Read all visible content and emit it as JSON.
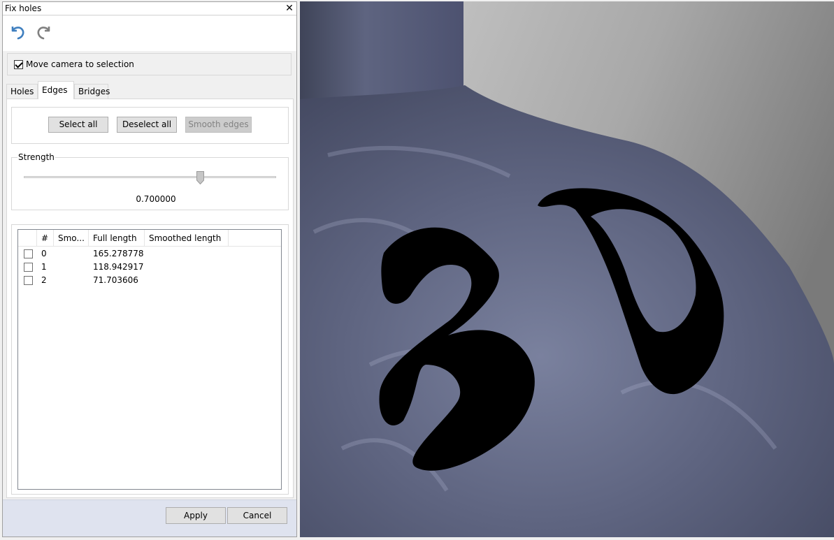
{
  "window": {
    "title": "Fix holes"
  },
  "toolbar": {
    "undo_icon": "undo-icon",
    "redo_icon": "redo-icon"
  },
  "options": {
    "move_camera_label": "Move camera to selection",
    "move_camera_checked": true
  },
  "tabs": [
    {
      "label": "Holes",
      "active": false
    },
    {
      "label": "Edges",
      "active": true
    },
    {
      "label": "Bridges",
      "active": false
    }
  ],
  "edges": {
    "select_all_label": "Select all",
    "deselect_all_label": "Deselect all",
    "smooth_edges_label": "Smooth edges",
    "strength_label": "Strength",
    "strength_value": "0.700000",
    "strength_fraction": 0.7
  },
  "table": {
    "columns": [
      "",
      "#",
      "Smo...",
      "Full length",
      "Smoothed length"
    ],
    "rows": [
      {
        "index": "0",
        "full_length": "165.278778"
      },
      {
        "index": "1",
        "full_length": "118.942917"
      },
      {
        "index": "2",
        "full_length": "71.703606"
      }
    ]
  },
  "footer": {
    "apply_label": "Apply",
    "cancel_label": "Cancel"
  },
  "colors": {
    "mesh": "#5b6078",
    "hole": "#000000",
    "accent_blue": "#3f7fbf"
  }
}
